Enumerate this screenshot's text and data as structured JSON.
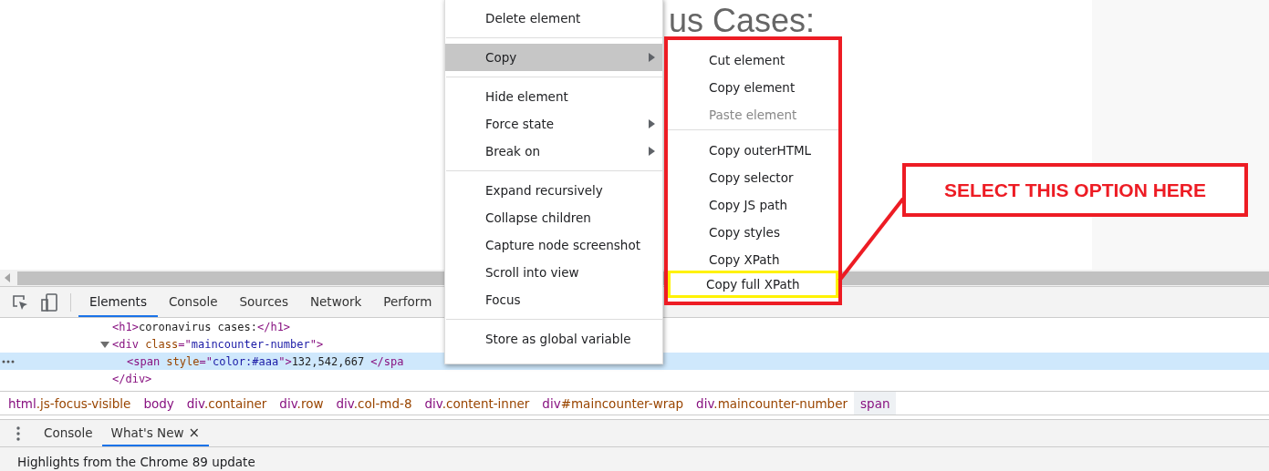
{
  "page": {
    "heading": "us Cases:"
  },
  "devtools": {
    "tabs": [
      {
        "label": "Elements",
        "selected": true
      },
      {
        "label": "Console",
        "selected": false
      },
      {
        "label": "Sources",
        "selected": false
      },
      {
        "label": "Network",
        "selected": false
      },
      {
        "label": "Perform",
        "selected": false
      }
    ],
    "dom_rows": [
      {
        "selected": false,
        "parts": [
          {
            "kind": "tag",
            "text": "<h1>"
          },
          {
            "kind": "text",
            "text": "coronavirus cases:"
          },
          {
            "kind": "tag",
            "text": "</h1>"
          }
        ]
      },
      {
        "selected": false,
        "expanded": true,
        "parts": [
          {
            "kind": "tag",
            "text": "<div "
          },
          {
            "kind": "attr",
            "text": "class"
          },
          {
            "kind": "tag",
            "text": "=\""
          },
          {
            "kind": "value",
            "text": "maincounter-number"
          },
          {
            "kind": "tag",
            "text": "\">"
          }
        ]
      },
      {
        "selected": true,
        "parts": [
          {
            "kind": "tag",
            "text": "<span "
          },
          {
            "kind": "attr",
            "text": "style"
          },
          {
            "kind": "tag",
            "text": "=\""
          },
          {
            "kind": "value",
            "text": "color:#aaa"
          },
          {
            "kind": "tag",
            "text": "\">"
          },
          {
            "kind": "text",
            "text": "132,542,667 "
          },
          {
            "kind": "tag",
            "text": "</spa"
          }
        ]
      },
      {
        "selected": false,
        "parts": [
          {
            "kind": "tag",
            "text": "</div>"
          }
        ]
      }
    ],
    "breadcrumbs": [
      {
        "tag": "html",
        "rest": ".js-focus-visible",
        "selected": false
      },
      {
        "tag": "body",
        "selected": false
      },
      {
        "tag": "div",
        "rest": ".container",
        "selected": false
      },
      {
        "tag": "div",
        "rest": ".row",
        "selected": false
      },
      {
        "tag": "div",
        "rest": ".col-md-8",
        "selected": false
      },
      {
        "tag": "div",
        "rest": ".content-inner",
        "selected": false
      },
      {
        "tag": "div",
        "rest": "#maincounter-wrap",
        "selected": false
      },
      {
        "tag": "div",
        "rest": ".maincounter-number",
        "selected": false
      },
      {
        "tag": "span",
        "selected": true
      }
    ],
    "drawer_tabs": [
      {
        "label": "Console",
        "selected": false,
        "closable": false
      },
      {
        "label": "What's New",
        "selected": true,
        "closable": true
      }
    ],
    "close_glyph": "×",
    "drawer_text": "Highlights from the Chrome 89 update"
  },
  "context_menu": {
    "groups": [
      [
        {
          "label": "Delete element",
          "selected": false,
          "has_submenu": false
        }
      ],
      [
        {
          "label": "Copy",
          "selected": true,
          "has_submenu": true
        }
      ],
      [
        {
          "label": "Hide element",
          "selected": false,
          "has_submenu": false
        },
        {
          "label": "Force state",
          "selected": false,
          "has_submenu": true
        },
        {
          "label": "Break on",
          "selected": false,
          "has_submenu": true
        }
      ],
      [
        {
          "label": "Expand recursively",
          "selected": false,
          "has_submenu": false
        },
        {
          "label": "Collapse children",
          "selected": false,
          "has_submenu": false
        },
        {
          "label": "Capture node screenshot",
          "selected": false,
          "has_submenu": false
        },
        {
          "label": "Scroll into view",
          "selected": false,
          "has_submenu": false
        },
        {
          "label": "Focus",
          "selected": false,
          "has_submenu": false
        }
      ],
      [
        {
          "label": "Store as global variable",
          "selected": false,
          "has_submenu": false
        }
      ]
    ]
  },
  "copy_submenu": {
    "groups": [
      [
        {
          "label": "Cut element",
          "disabled": false,
          "highlighted": false
        },
        {
          "label": "Copy element",
          "disabled": false,
          "highlighted": false
        },
        {
          "label": "Paste element",
          "disabled": true,
          "highlighted": false
        }
      ],
      [
        {
          "label": "Copy outerHTML",
          "disabled": false,
          "highlighted": false
        },
        {
          "label": "Copy selector",
          "disabled": false,
          "highlighted": false
        },
        {
          "label": "Copy JS path",
          "disabled": false,
          "highlighted": false
        },
        {
          "label": "Copy styles",
          "disabled": false,
          "highlighted": false
        },
        {
          "label": "Copy XPath",
          "disabled": false,
          "highlighted": false
        },
        {
          "label": "Copy full XPath",
          "disabled": false,
          "highlighted": true
        }
      ]
    ]
  },
  "annotation": {
    "callout": "SELECT THIS OPTION HERE"
  }
}
